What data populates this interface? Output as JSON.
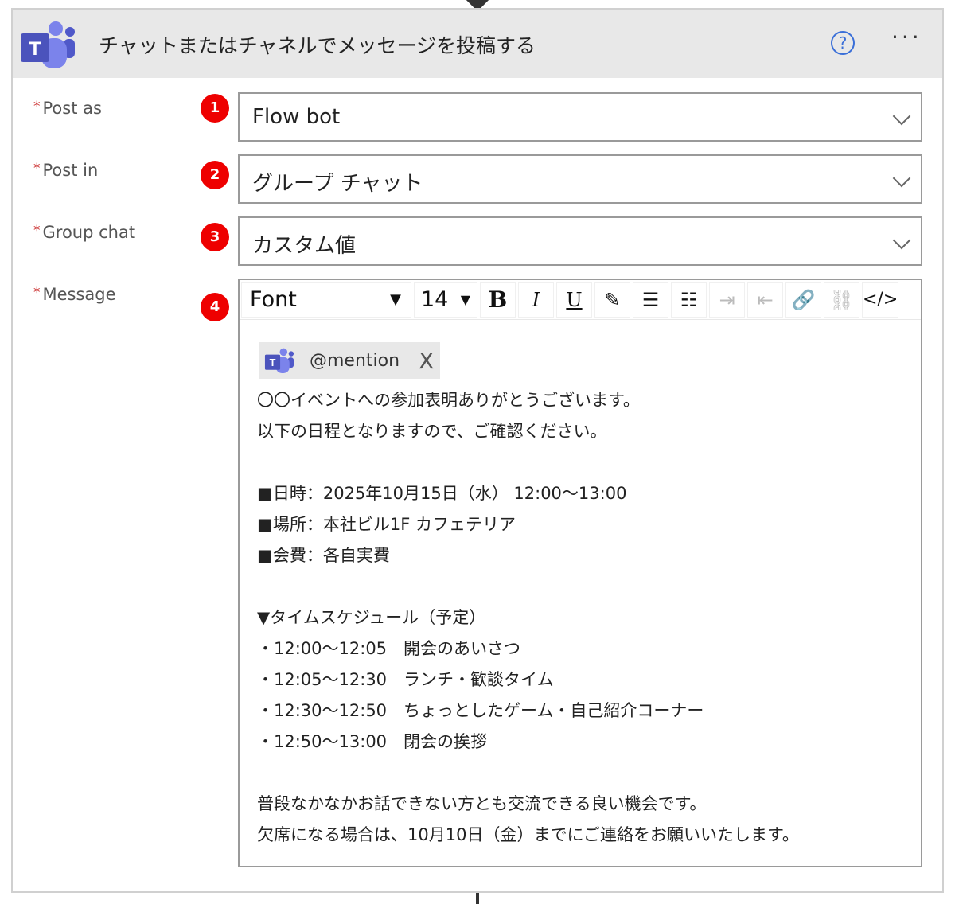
{
  "header": {
    "title": "チャットまたはチャネルでメッセージを投稿する",
    "help_icon": "?",
    "more_icon": "···"
  },
  "fields": [
    {
      "label": "Post as",
      "required": "*",
      "badge": "1",
      "value": "Flow bot"
    },
    {
      "label": "Post in",
      "required": "*",
      "badge": "2",
      "value": "グループ チャット"
    },
    {
      "label": "Group chat",
      "required": "*",
      "badge": "3",
      "value": "カスタム値"
    }
  ],
  "message": {
    "label": "Message",
    "required": "*",
    "badge": "4",
    "toolbar": {
      "font": "Font",
      "size": "14",
      "bold": "B",
      "italic": "I",
      "underline": "U",
      "code": "</>"
    },
    "mention": "@mention",
    "mention_close": "X",
    "lines": [
      "〇〇イベントへの参加表明ありがとうございます。",
      "以下の日程となりますので、ご確認ください。",
      "",
      "■日時：2025年10月15日（水） 12:00〜13:00",
      "■場所：本社ビル1F カフェテリア",
      "■会費：各自実費",
      "",
      "▼タイムスケジュール（予定）",
      "・12:00〜12:05　開会のあいさつ",
      "・12:05〜12:30　ランチ・歓談タイム",
      "・12:30〜12:50　ちょっとしたゲーム・自己紹介コーナー",
      "・12:50〜13:00　閉会の挨拶",
      "",
      "普段なかなかお話できない方とも交流できる良い機会です。",
      "欠席になる場合は、10月10日（金）までにご連絡をお願いいたします。"
    ]
  }
}
